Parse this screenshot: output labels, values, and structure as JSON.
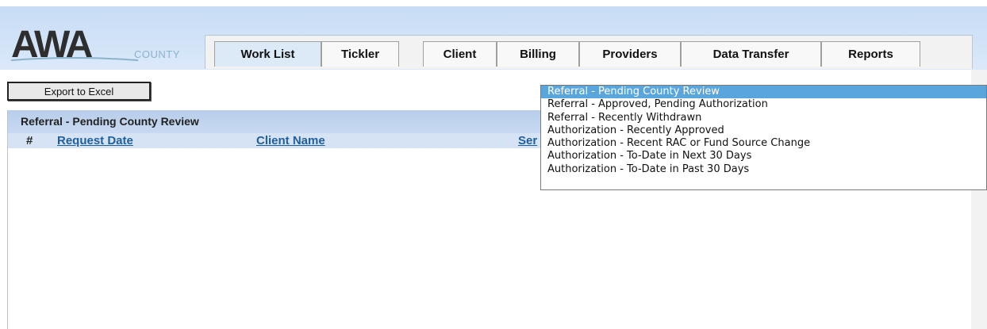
{
  "logo": {
    "main": "AWA",
    "sub": "COUNTY"
  },
  "tabs": [
    {
      "label": "Work List",
      "active": true
    },
    {
      "label": "Tickler"
    },
    {
      "label": "Client"
    },
    {
      "label": "Billing"
    },
    {
      "label": "Providers"
    },
    {
      "label": "Data Transfer"
    },
    {
      "label": "Reports"
    }
  ],
  "toolbar": {
    "export_label": "Export to Excel"
  },
  "panel": {
    "title": "Referral - Pending County Review",
    "columns": {
      "hash": "#",
      "request_date": "Request Date",
      "client_name": "Client Name",
      "service": "Ser"
    }
  },
  "dropdown": {
    "selected_index": 0,
    "options": [
      "Referral - Pending County Review",
      "Referral - Approved, Pending Authorization",
      "Referral - Recently Withdrawn",
      "Authorization - Recently Approved",
      "Authorization - Recent RAC or Fund Source Change",
      "Authorization - To-Date in Next 30 Days",
      "Authorization - To-Date in Past 30 Days"
    ]
  },
  "colors": {
    "selected_bg": "#5aa6dc",
    "link": "#1f5f9c",
    "header_bg": "#c7dcf5"
  }
}
